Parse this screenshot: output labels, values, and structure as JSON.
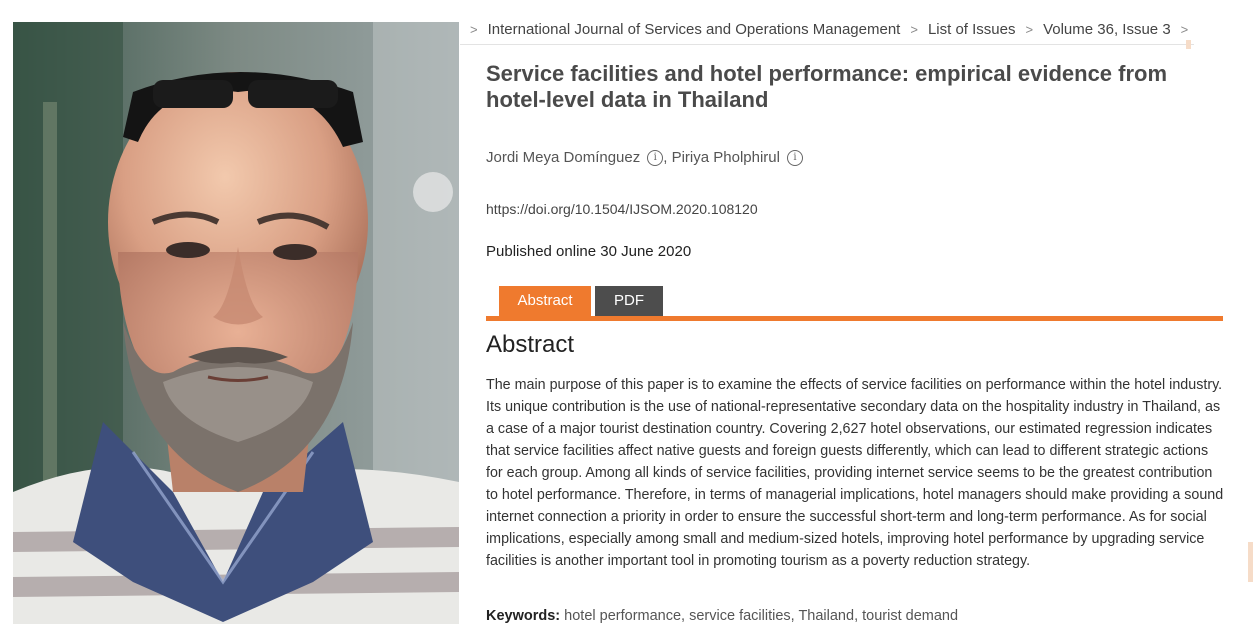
{
  "breadcrumb": {
    "items": [
      "International Journal of Services and Operations Management",
      "List of Issues",
      "Volume 36, Issue 3"
    ]
  },
  "article": {
    "title": "Service facilities and hotel performance: empirical evidence from hotel-level data in Thailand",
    "authors": [
      {
        "name": "Jordi Meya Domínguez",
        "info_icon": "info-circle-icon"
      },
      {
        "name": "Piriya Pholphirul",
        "info_icon": "info-circle-icon"
      }
    ],
    "author_separator": ", ",
    "doi": "https://doi.org/10.1504/IJSOM.2020.108120",
    "published": "Published online 30 June 2020"
  },
  "tabs": {
    "abstract_label": "Abstract",
    "pdf_label": "PDF",
    "active": "Abstract",
    "active_color": "#ef7a2e",
    "inactive_color": "#4d4d4d"
  },
  "abstract": {
    "heading": "Abstract",
    "text": "The main purpose of this paper is to examine the effects of service facilities on performance within the hotel industry. Its unique contribution is the use of national-representative secondary data on the hospitality industry in Thailand, as a case of a major tourist destination country. Covering 2,627 hotel observations, our estimated regression indicates that service facilities affect native guests and foreign guests differently, which can lead to different strategic actions for each group. Among all kinds of service facilities, providing internet service seems to be the greatest contribution to hotel performance. Therefore, in terms of managerial implications, hotel managers should make providing a sound internet connection a priority in order to ensure the successful short-term and long-term performance. As for social implications, especially among small and medium-sized hotels, improving hotel performance by upgrading service facilities is another important tool in promoting tourism as a poverty reduction strategy."
  },
  "keywords": {
    "label": "Keywords:",
    "items": [
      "hotel performance",
      "service facilities",
      "Thailand",
      "tourist demand"
    ]
  },
  "colors": {
    "accent": "#ef7a2e",
    "title": "#4a4a4a"
  }
}
